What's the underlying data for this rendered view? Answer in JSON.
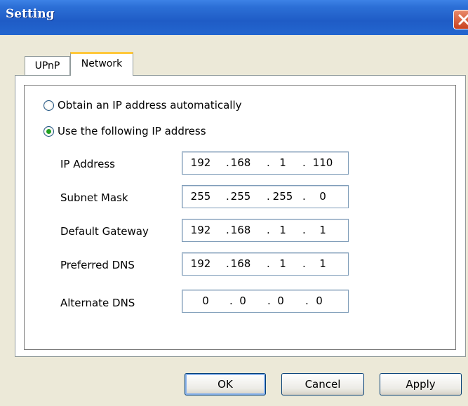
{
  "window": {
    "title": "Setting",
    "close_icon": "close-icon"
  },
  "tabs": [
    {
      "label": "UPnP",
      "selected": false
    },
    {
      "label": "Network",
      "selected": true
    }
  ],
  "ip_mode": {
    "auto_label": "Obtain an IP address automatically",
    "manual_label": "Use the following IP address",
    "selected": "manual"
  },
  "fields": [
    {
      "label": "IP Address",
      "octets": [
        "192",
        "168",
        "1",
        "110"
      ]
    },
    {
      "label": "Subnet Mask",
      "octets": [
        "255",
        "255",
        "255",
        "0"
      ]
    },
    {
      "label": "Default Gateway",
      "octets": [
        "192",
        "168",
        "1",
        "1"
      ]
    },
    {
      "label": "Preferred DNS",
      "octets": [
        "192",
        "168",
        "1",
        "1"
      ]
    },
    {
      "label": "Alternate DNS",
      "octets": [
        "0",
        "0",
        "0",
        "0"
      ]
    }
  ],
  "buttons": {
    "ok": "OK",
    "cancel": "Cancel",
    "apply": "Apply"
  },
  "colors": {
    "titlebar": "#2c6fd6",
    "tab_highlight": "#ffc83c",
    "radio_dot": "#21a121"
  }
}
